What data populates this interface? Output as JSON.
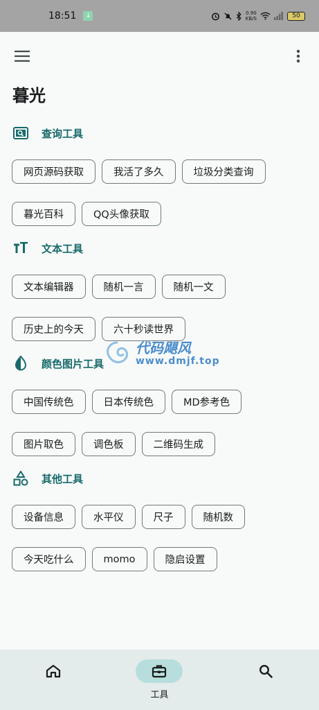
{
  "status_bar": {
    "time": "18:51",
    "speed_value": "0.90",
    "speed_unit": "KB/S",
    "battery": "50"
  },
  "app": {
    "title": "暮光"
  },
  "sections": [
    {
      "title": "查询工具",
      "icon": "search-box-icon",
      "rows": [
        [
          "网页源码获取",
          "我活了多久",
          "垃圾分类查询"
        ],
        [
          "暮光百科",
          "QQ头像获取"
        ]
      ]
    },
    {
      "title": "文本工具",
      "icon": "text-size-icon",
      "rows": [
        [
          "文本编辑器",
          "随机一言",
          "随机一文"
        ],
        [
          "历史上的今天",
          "六十秒读世界"
        ]
      ]
    },
    {
      "title": "颜色图片工具",
      "icon": "color-drop-icon",
      "rows": [
        [
          "中国传统色",
          "日本传统色",
          "MD参考色"
        ],
        [
          "图片取色",
          "调色板",
          "二维码生成"
        ]
      ]
    },
    {
      "title": "其他工具",
      "icon": "shapes-icon",
      "rows": [
        [
          "设备信息",
          "水平仪",
          "尺子",
          "随机数"
        ],
        [
          "今天吃什么",
          "momo",
          "隐启设置"
        ]
      ]
    }
  ],
  "watermark": {
    "line1": "代码飓风",
    "line2": "www.dmjf.top"
  },
  "bottom_nav": {
    "items": [
      {
        "icon": "home-icon",
        "label": ""
      },
      {
        "icon": "toolbox-icon",
        "label": "工具"
      },
      {
        "icon": "search-icon",
        "label": ""
      }
    ],
    "active_index": 1
  },
  "colors": {
    "accent": "#176a6a",
    "nav_background": "#e3eceb",
    "nav_active_pill": "#b7dedd",
    "chip_border": "#6f7979"
  }
}
